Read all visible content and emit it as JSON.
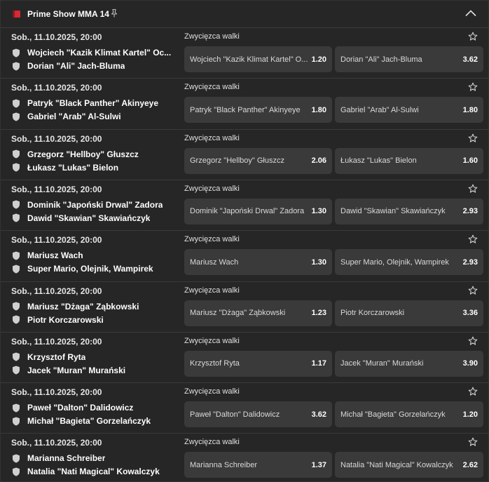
{
  "header": {
    "title": "Prime Show MMA 14",
    "flag_icon": "poland-flag-icon",
    "pin_icon": "pin-icon",
    "collapse_icon": "chevron-up-icon"
  },
  "colors": {
    "panel_bg": "#262626",
    "odd_bg": "#3a3a3a",
    "flag_red": "#d32a33"
  },
  "events": [
    {
      "date": "Sob., 11.10.2025, 20:00",
      "market": "Zwycięzca walki",
      "home": "Wojciech \"Kazik Klimat Kartel\" Oc...",
      "away": "Dorian \"Ali\" Jach-Bluma",
      "odd1_label": "Wojciech \"Kazik Klimat Kartel\" O...",
      "odd1_value": "1.20",
      "odd2_label": "Dorian \"Ali\" Jach-Bluma",
      "odd2_value": "3.62"
    },
    {
      "date": "Sob., 11.10.2025, 20:00",
      "market": "Zwycięzca walki",
      "home": "Patryk \"Black Panther\" Akinyeye",
      "away": "Gabriel \"Arab\" Al-Sulwi",
      "odd1_label": "Patryk \"Black Panther\" Akinyeye",
      "odd1_value": "1.80",
      "odd2_label": "Gabriel \"Arab\" Al-Sulwi",
      "odd2_value": "1.80"
    },
    {
      "date": "Sob., 11.10.2025, 20:00",
      "market": "Zwycięzca walki",
      "home": "Grzegorz \"Hellboy\" Głuszcz",
      "away": "Łukasz \"Lukas\" Bielon",
      "odd1_label": "Grzegorz \"Hellboy\" Głuszcz",
      "odd1_value": "2.06",
      "odd2_label": "Łukasz \"Lukas\" Bielon",
      "odd2_value": "1.60"
    },
    {
      "date": "Sob., 11.10.2025, 20:00",
      "market": "Zwycięzca walki",
      "home": "Dominik \"Japoński Drwal\" Zadora",
      "away": "Dawid \"Skawian\" Skawiańczyk",
      "odd1_label": "Dominik \"Japoński Drwal\" Zadora",
      "odd1_value": "1.30",
      "odd2_label": "Dawid \"Skawian\" Skawiańczyk",
      "odd2_value": "2.93"
    },
    {
      "date": "Sob., 11.10.2025, 20:00",
      "market": "Zwycięzca walki",
      "home": "Mariusz Wach",
      "away": "Super Mario, Olejnik, Wampirek",
      "odd1_label": "Mariusz Wach",
      "odd1_value": "1.30",
      "odd2_label": "Super Mario, Olejnik, Wampirek",
      "odd2_value": "2.93"
    },
    {
      "date": "Sob., 11.10.2025, 20:00",
      "market": "Zwycięzca walki",
      "home": "Mariusz \"Dżaga\" Ząbkowski",
      "away": "Piotr Korczarowski",
      "odd1_label": "Mariusz \"Dżaga\" Ząbkowski",
      "odd1_value": "1.23",
      "odd2_label": "Piotr Korczarowski",
      "odd2_value": "3.36"
    },
    {
      "date": "Sob., 11.10.2025, 20:00",
      "market": "Zwycięzca walki",
      "home": "Krzysztof Ryta",
      "away": "Jacek \"Muran\" Murański",
      "odd1_label": "Krzysztof Ryta",
      "odd1_value": "1.17",
      "odd2_label": "Jacek \"Muran\" Murański",
      "odd2_value": "3.90"
    },
    {
      "date": "Sob., 11.10.2025, 20:00",
      "market": "Zwycięzca walki",
      "home": "Paweł \"Dalton\" Dalidowicz",
      "away": "Michał \"Bagieta\" Gorzelańczyk",
      "odd1_label": "Paweł \"Dalton\" Dalidowicz",
      "odd1_value": "3.62",
      "odd2_label": "Michał \"Bagieta\" Gorzelańczyk",
      "odd2_value": "1.20"
    },
    {
      "date": "Sob., 11.10.2025, 20:00",
      "market": "Zwycięzca walki",
      "home": "Marianna Schreiber",
      "away": "Natalia \"Nati Magical\" Kowalczyk",
      "odd1_label": "Marianna Schreiber",
      "odd1_value": "1.37",
      "odd2_label": "Natalia \"Nati Magical\" Kowalczyk",
      "odd2_value": "2.62"
    }
  ]
}
